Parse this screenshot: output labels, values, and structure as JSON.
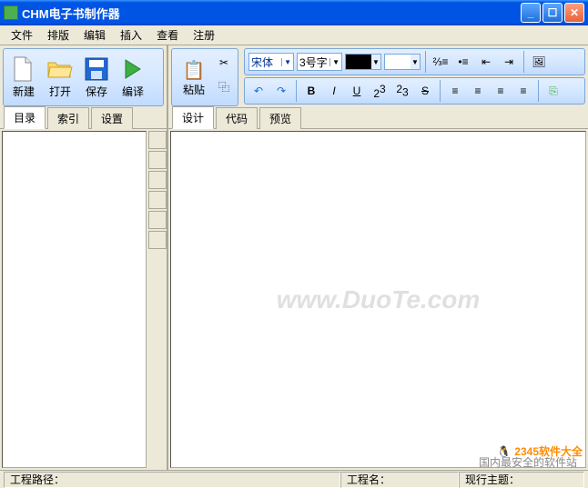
{
  "window": {
    "title": "CHM电子书制作器"
  },
  "menu": {
    "file": "文件",
    "layout": "排版",
    "edit": "编辑",
    "insert": "插入",
    "view": "查看",
    "register": "注册"
  },
  "leftToolbar": {
    "new": "新建",
    "open": "打开",
    "save": "保存",
    "compile": "编译"
  },
  "rightToolbar": {
    "paste": "粘贴",
    "fontName": "宋体",
    "fontSize": "3号字",
    "fgColor": "#000000",
    "bgColor": "#ffffff",
    "bold": "B",
    "italic": "I",
    "underline": "U",
    "sup": "2",
    "supx": "3",
    "sub": "2",
    "subx": "3",
    "strike": "S"
  },
  "leftTabs": {
    "toc": "目录",
    "index": "索引",
    "settings": "设置"
  },
  "rightTabs": {
    "design": "设计",
    "code": "代码",
    "preview": "预览"
  },
  "status": {
    "projectPath": "工程路径：",
    "projectName": "工程名：",
    "currentTopic": "现行主题："
  },
  "watermark": "www.DuoTe.com",
  "overlay": {
    "logo": "2345软件大全",
    "tagline": "国内最安全的软件站"
  }
}
